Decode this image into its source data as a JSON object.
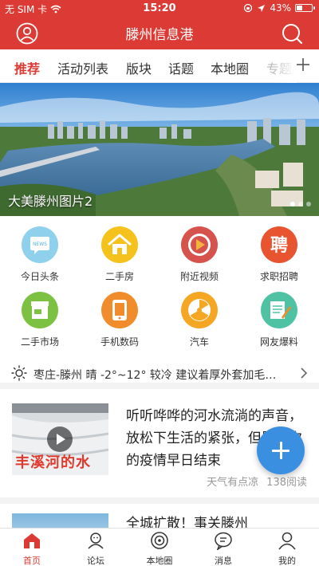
{
  "status_bar": {
    "carrier": "无 SIM 卡",
    "time": "15:20",
    "battery": "43%",
    "battery_level": 0.43
  },
  "header": {
    "title": "滕州信息港",
    "user_icon": "user-icon",
    "search_icon": "search-icon"
  },
  "tabs": {
    "items": [
      "推荐",
      "活动列表",
      "版块",
      "话题",
      "本地圈",
      "专题"
    ],
    "active_index": 0,
    "plus_icon": "plus-icon"
  },
  "banner": {
    "caption": "大美滕州图片2",
    "dot_count": 3,
    "active_dot": 0
  },
  "quick_links": [
    {
      "label": "今日头条",
      "icon": "news-icon",
      "color": "#7cc7e6"
    },
    {
      "label": "二手房",
      "icon": "house-icon",
      "color": "#f4c21b"
    },
    {
      "label": "附近视频",
      "icon": "video-play-icon",
      "color": "#d6524c"
    },
    {
      "label": "求职招聘",
      "icon": "recruit-icon",
      "color": "#e8542f"
    },
    {
      "label": "二手市场",
      "icon": "shop-icon",
      "color": "#7cc142"
    },
    {
      "label": "手机数码",
      "icon": "phone-touch-icon",
      "color": "#f08c2b"
    },
    {
      "label": "汽车",
      "icon": "car-wheel-icon",
      "color": "#f5a623"
    },
    {
      "label": "网友爆料",
      "icon": "note-pen-icon",
      "color": "#4fc2a4"
    }
  ],
  "weather": {
    "text": "枣庄-滕州 晴 -2°~12° 较冷 建议着厚外套加毛…",
    "icon": "sun-icon"
  },
  "news": [
    {
      "title": "听听哗哗的河水流淌的声音，放松下生活的紧张，但愿这次的疫情早日结束",
      "thumb_text": "丰溪河的水",
      "author": "天气有点凉",
      "reads": "138阅读"
    },
    {
      "title": "全城扩散！事关滕州"
    }
  ],
  "fab": {
    "icon": "plus-icon",
    "color": "#3a8fe0"
  },
  "bottom_nav": {
    "items": [
      {
        "label": "首页",
        "icon": "home-icon"
      },
      {
        "label": "论坛",
        "icon": "forum-icon"
      },
      {
        "label": "本地圈",
        "icon": "local-circle-icon"
      },
      {
        "label": "消息",
        "icon": "message-icon"
      },
      {
        "label": "我的",
        "icon": "profile-icon"
      }
    ],
    "active_index": 0
  },
  "colors": {
    "brand_red": "#dc3b35",
    "accent_blue": "#3a8fe0"
  }
}
